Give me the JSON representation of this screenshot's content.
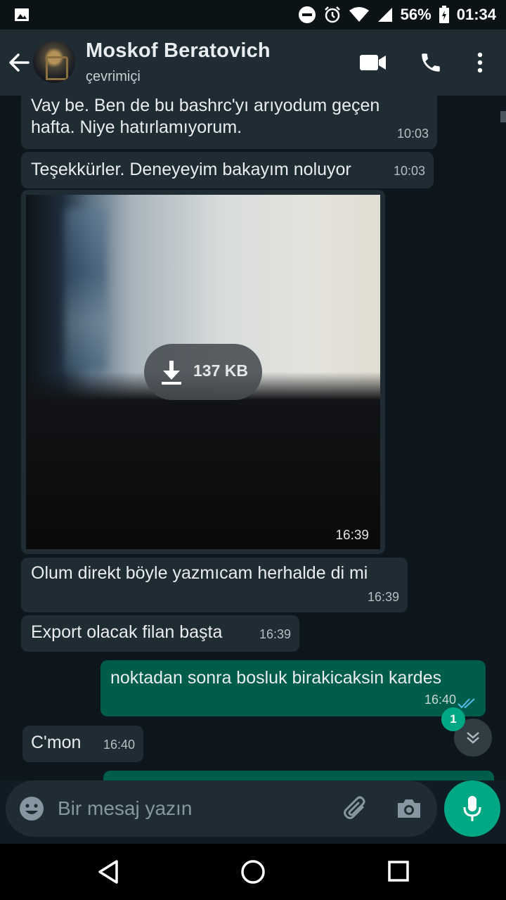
{
  "status_bar": {
    "battery": "56%",
    "time": "01:34",
    "icons": [
      "gallery-icon",
      "dnd-icon",
      "alarm-icon",
      "wifi-icon",
      "signal-icon",
      "battery-icon"
    ]
  },
  "header": {
    "contact_name": "Moskof Beratovich",
    "contact_status": "çevrimiçi",
    "icons": [
      "back-arrow-icon",
      "video-call-icon",
      "phone-icon",
      "more-vert-icon"
    ]
  },
  "messages": [
    {
      "direction": "in",
      "lines": [
        "Vay be. Ben de bu bashrc'yı arıyodum geçen",
        "hafta. Niye hatırlamıyorum."
      ],
      "time": "10:03"
    },
    {
      "direction": "in",
      "text": "Teşekkürler. Deneyeyim bakayım noluyor",
      "time": "10:03"
    },
    {
      "direction": "in",
      "type": "image",
      "download_size": "137 KB",
      "time": "16:39"
    },
    {
      "direction": "in",
      "text": "Olum direkt böyle yazmıcam herhalde di mi",
      "time": "16:39"
    },
    {
      "direction": "in",
      "text": "Export olacak filan başta",
      "time": "16:39"
    },
    {
      "direction": "out",
      "text": "noktadan sonra bosluk birakicaksin kardes",
      "time": "16:40",
      "status": "read"
    },
    {
      "direction": "in",
      "text": "C'mon",
      "time": "16:40"
    }
  ],
  "unread_count": "1",
  "composer": {
    "placeholder": "Bir mesaj yazın",
    "value": ""
  },
  "colors": {
    "incoming_bubble": "#202c33",
    "outgoing_bubble": "#005c4b",
    "accent": "#00a884",
    "read_ticks": "#53bdeb"
  }
}
